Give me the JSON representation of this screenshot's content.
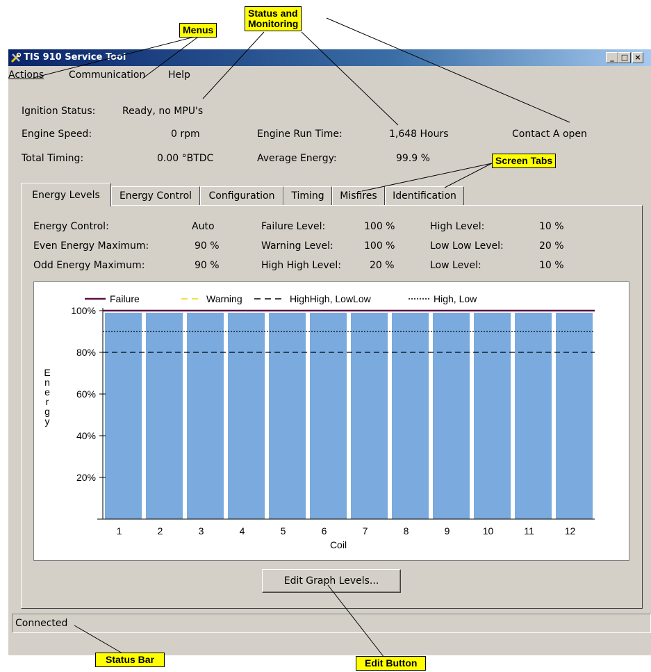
{
  "window": {
    "title": "TIS 910 Service Tool"
  },
  "window_buttons": {
    "minimize": "_",
    "maximize": "□",
    "close": "×"
  },
  "menus": [
    {
      "label": "Actions"
    },
    {
      "label": "Communication"
    },
    {
      "label": "Help"
    }
  ],
  "status": {
    "ignition_label": "Ignition Status:",
    "ignition_value": "Ready, no MPU's",
    "speed_label": "Engine Speed:",
    "speed_value": "0 rpm",
    "runtime_label": "Engine Run Time:",
    "runtime_value": "1,648 Hours",
    "contact": "Contact A open",
    "timing_label": "Total Timing:",
    "timing_value": "0.00 °BTDC",
    "energy_label": "Average Energy:",
    "energy_value": "99.9 %"
  },
  "tabs": [
    {
      "label": "Energy Levels",
      "active": true
    },
    {
      "label": "Energy Control"
    },
    {
      "label": "Configuration"
    },
    {
      "label": "Timing"
    },
    {
      "label": "Misfires"
    },
    {
      "label": "Identification"
    }
  ],
  "levels": {
    "energy_control_label": "Energy Control:",
    "energy_control_value": "Auto",
    "even_max_label": "Even Energy Maximum:",
    "even_max_value": "90 %",
    "odd_max_label": "Odd Energy Maximum:",
    "odd_max_value": "90 %",
    "failure_label": "Failure Level:",
    "failure_value": "100 %",
    "warning_label": "Warning Level:",
    "warning_value": "100 %",
    "highhigh_label": "High High Level:",
    "highhigh_value": "20 %",
    "high_label": "High Level:",
    "high_value": "10 %",
    "lowlow_label": "Low Low Level:",
    "lowlow_value": "20 %",
    "low_label": "Low Level:",
    "low_value": "10 %"
  },
  "chart_data": {
    "type": "bar",
    "categories": [
      "1",
      "2",
      "3",
      "4",
      "5",
      "6",
      "7",
      "8",
      "9",
      "10",
      "11",
      "12"
    ],
    "values": [
      99,
      99,
      99,
      99,
      99,
      99,
      99,
      99,
      99,
      99,
      99,
      99
    ],
    "xlabel": "Coil",
    "ylabel": "Energy",
    "ylim": [
      0,
      100
    ],
    "yticks": [
      "20%",
      "40%",
      "60%",
      "80%",
      "100%"
    ],
    "ytick_values": [
      20,
      40,
      60,
      80,
      100
    ],
    "bar_color": "#7aaade",
    "lines": [
      {
        "name": "Failure",
        "value": 100,
        "style": "solid",
        "color": "#5a1040"
      },
      {
        "name": "Warning",
        "value": 100,
        "style": "dashed",
        "color": "#e8d800"
      },
      {
        "name": "HighHigh, LowLow",
        "value": 80,
        "style": "dashed",
        "color": "#000000"
      },
      {
        "name": "High, Low",
        "value": 90,
        "style": "dotted",
        "color": "#000000"
      }
    ],
    "legend": "top"
  },
  "edit_button": {
    "label": "Edit Graph Levels..."
  },
  "statusbar": {
    "text": "Connected"
  },
  "callouts": {
    "menus": "Menus",
    "status_1": "Status and",
    "status_2": "Monitoring",
    "tabs": "Screen Tabs",
    "status_bar": "Status Bar",
    "edit_button": "Edit Button"
  }
}
